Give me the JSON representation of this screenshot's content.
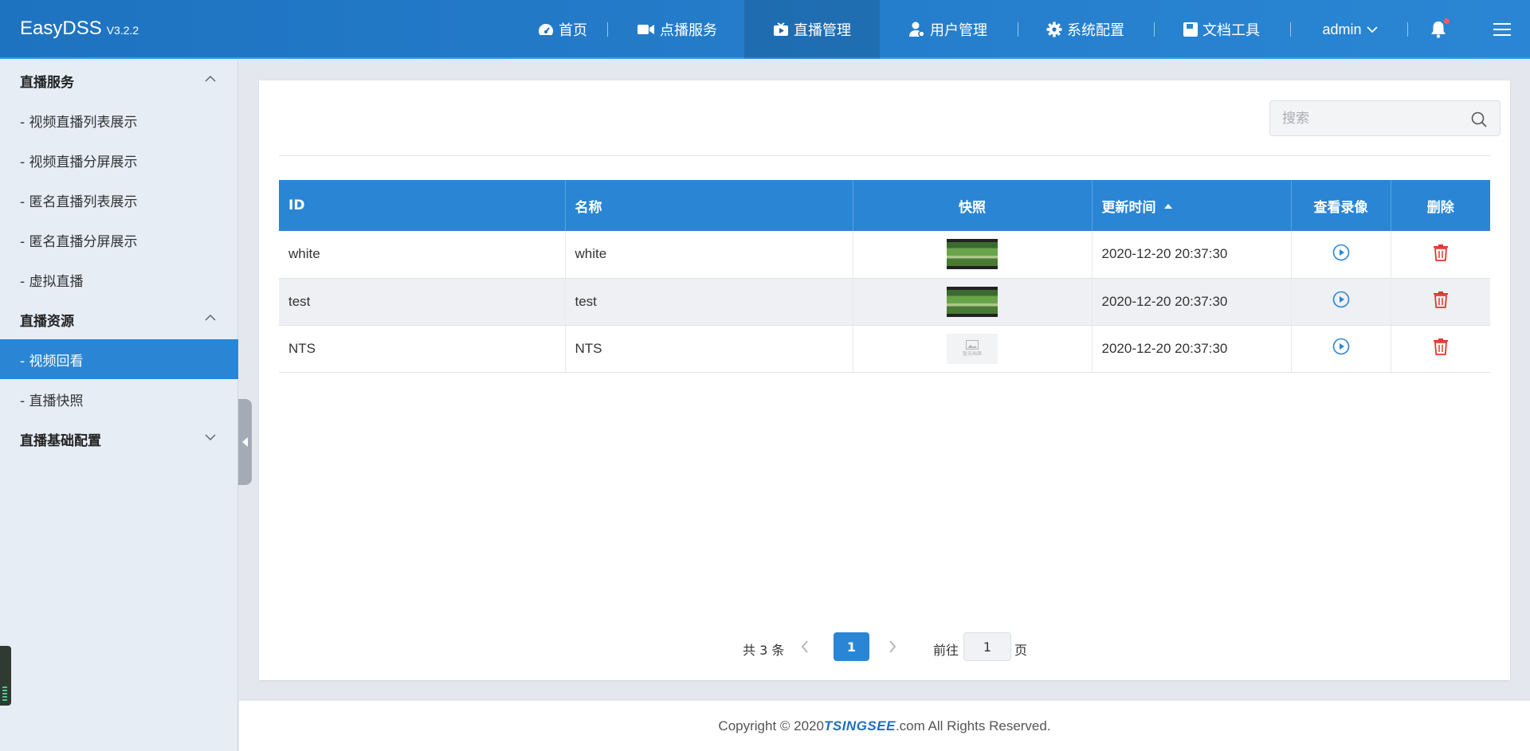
{
  "app": {
    "name": "EasyDSS",
    "version": "V3.2.2"
  },
  "nav": {
    "home": "首页",
    "vod": "点播服务",
    "live": "直播管理",
    "users": "用户管理",
    "system": "系统配置",
    "docs": "文档工具",
    "user": "admin"
  },
  "sidebar": {
    "group1": "直播服务",
    "items1": [
      "- 视频直播列表展示",
      "- 视频直播分屏展示",
      "- 匿名直播列表展示",
      "- 匿名直播分屏展示",
      "- 虚拟直播"
    ],
    "group2": "直播资源",
    "items2": [
      "- 视频回看",
      "- 直播快照"
    ],
    "group3": "直播基础配置"
  },
  "search": {
    "placeholder": "搜索"
  },
  "table": {
    "headers": [
      "ID",
      "名称",
      "快照",
      "更新时间",
      "查看录像",
      "删除"
    ],
    "rows": [
      {
        "id": "white",
        "name": "white",
        "snapshot": "video",
        "updated": "2020-12-20 20:37:30"
      },
      {
        "id": "test",
        "name": "test",
        "snapshot": "video",
        "updated": "2020-12-20 20:37:30"
      },
      {
        "id": "NTS",
        "name": "NTS",
        "snapshot": "empty",
        "updated": "2020-12-20 20:37:30"
      }
    ],
    "empty_thumb_text": "暂无画面"
  },
  "pagination": {
    "total": "共 3 条",
    "current": "1",
    "goto_label": "前往",
    "goto_value": "1",
    "unit": "页"
  },
  "footer": {
    "prefix": "Copyright © 2020 ",
    "brand": "TSINGSEE",
    "suffix": ".com All Rights Reserved."
  },
  "colors": {
    "primary": "#2a86d4",
    "header_start": "#1e73c0",
    "danger": "#e2382c",
    "sidebar_bg": "#e6edf5"
  }
}
